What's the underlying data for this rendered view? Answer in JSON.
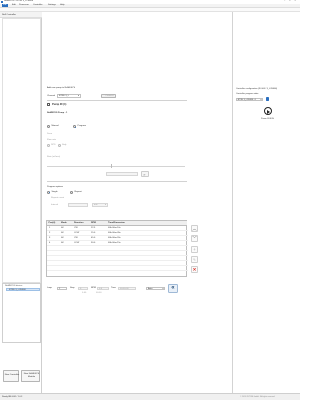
{
  "window": {
    "title": "NeMESYS - BTXE 3_LCE666"
  },
  "menu": {
    "items": [
      "File",
      "Edit",
      "Prozessrn",
      "Controller",
      "Settings",
      "Help"
    ]
  },
  "toolbar": {},
  "left_panel": {
    "tab": "Nefl Controller",
    "tree_items": [
      "NeMESYS device",
      "BTXE 3_LCE666"
    ],
    "new_button_label": "New Controller",
    "new_pump_button_label": "New NeMESYS Module"
  },
  "center": {
    "header": "Add new pump to NeMESYS",
    "device_label": "Channel",
    "device_value": "BTXE 3_L",
    "add_button_label": "Connect",
    "pump_title": "Pump ID (1)",
    "pump_subtitle": "NeMESYS Pump - 1",
    "mode_manual": "Manual",
    "mode_program": "Program",
    "dose_label": "Dose",
    "flow_label": "Flow rate",
    "opt_a": "DPD",
    "opt_b": "Stdy",
    "rate_label": "Rate (ml/min)",
    "program_section": "Program options",
    "prog_single": "Single",
    "prog_repeat": "Repeat",
    "repeat_count_label": "Repeat count",
    "interval_label": "Interval",
    "interval_unit": "min",
    "table": {
      "headers": [
        "Pos(#)",
        "Mode",
        "Direction",
        "RPM",
        "Time/Dimension"
      ],
      "rows": [
        [
          "1",
          "0K",
          "CW",
          "22.5",
          "00h:00m:10s"
        ],
        [
          "2",
          "0K",
          "CCW",
          "15.0",
          "00h:00m:05s"
        ],
        [
          "3",
          "0K",
          "CW",
          "45.0",
          "00h:00m:20s"
        ],
        [
          "4",
          "0K",
          "CCW",
          "30.0",
          "00h:00m:15s"
        ]
      ]
    },
    "bottom": {
      "label_a": "Loop",
      "field_a": "1",
      "label_b": "Step",
      "field_b": "0",
      "label_c": "RPM",
      "field_c": "0.0",
      "label_d": "Time",
      "field_d": "00:00:00",
      "select_value": "Auto",
      "sub_a": "0.00",
      "sub_b": "00:00"
    }
  },
  "right_panel": {
    "title": "Controller configuration (ID 006 / 3_LCE666)",
    "subtitle": "Controller program state",
    "select_value": "BTXE 3_LCE666 - 0",
    "play_caption": "Pause ID/SCH"
  },
  "status_bar": {
    "left": "Ready     BN 0001 / 1.0.3",
    "right": "© 2019 CETONI GmbH · All rights reserved"
  },
  "colors": {
    "accent": "#2a6fc0",
    "stop": "#d9382f",
    "play": "#222222"
  }
}
